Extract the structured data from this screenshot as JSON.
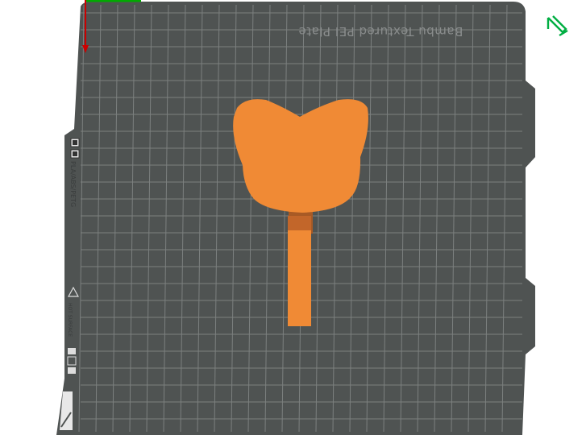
{
  "plate": {
    "name": "Bambu Textured PEI Plate",
    "filament_label": "PLA/ABS/PETG",
    "surface_label": "HOT SURFACE"
  },
  "colors": {
    "plate": "#4f5352",
    "grid": "#7c807f",
    "object": "#f08a35",
    "object_shadow": "#c2662a",
    "axis_y": "#00aa00",
    "axis_z": "#cc0000",
    "edit_icon": "#00ae42"
  },
  "icons": {
    "edit": "pencil-icon",
    "warning": "warning-triangle-icon",
    "logo": "bambu-logo-icon"
  }
}
